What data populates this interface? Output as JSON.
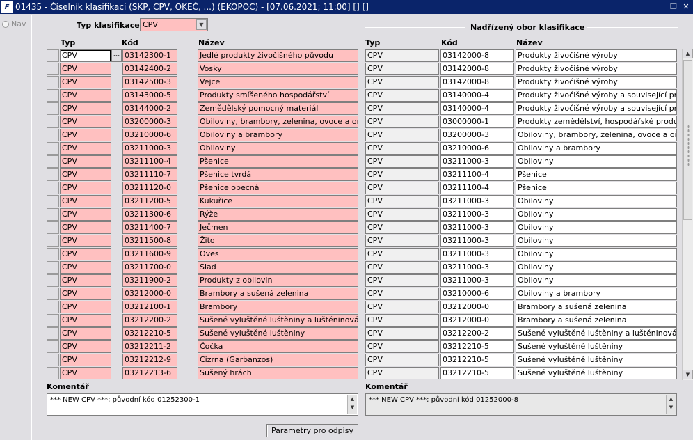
{
  "window": {
    "title": "01435 - Číselník klasifikací (SKP, CPV, OKEČ, ...) (EKOPOC) - [07.06.2021; 11:00]  [] []",
    "icon_text": "F"
  },
  "nav": {
    "label": "Nav"
  },
  "filter": {
    "label": "Typ klasifikace",
    "value": "CPV"
  },
  "left_headers": {
    "typ": "Typ",
    "kod": "Kód",
    "nazev": "Název"
  },
  "right_group": {
    "title": "Nadřízený obor klasifikace"
  },
  "right_headers": {
    "typ": "Typ",
    "kod": "Kód",
    "nazev": "Název"
  },
  "rows": [
    {
      "typ": "CPV",
      "kod": "03142300-1",
      "nazev": "Jedlé produkty živočišného původu",
      "p_typ": "CPV",
      "p_kod": "03142000-8",
      "p_nazev": "Produkty živočišné výroby"
    },
    {
      "typ": "CPV",
      "kod": "03142400-2",
      "nazev": "Vosky",
      "p_typ": "CPV",
      "p_kod": "03142000-8",
      "p_nazev": "Produkty živočišné výroby"
    },
    {
      "typ": "CPV",
      "kod": "03142500-3",
      "nazev": "Vejce",
      "p_typ": "CPV",
      "p_kod": "03142000-8",
      "p_nazev": "Produkty živočišné výroby"
    },
    {
      "typ": "CPV",
      "kod": "03143000-5",
      "nazev": "Produkty smíšeného hospodářství",
      "p_typ": "CPV",
      "p_kod": "03140000-4",
      "p_nazev": "Produkty živočišné výroby a související produkt"
    },
    {
      "typ": "CPV",
      "kod": "03144000-2",
      "nazev": "Zemědělský pomocný materiál",
      "p_typ": "CPV",
      "p_kod": "03140000-4",
      "p_nazev": "Produkty živočišné výroby a související produkt"
    },
    {
      "typ": "CPV",
      "kod": "03200000-3",
      "nazev": "Obiloviny, brambory, zelenina, ovoce a ořechy",
      "p_typ": "CPV",
      "p_kod": "03000000-1",
      "p_nazev": "Produkty zemědělství, hospodářské produkty, p"
    },
    {
      "typ": "CPV",
      "kod": "03210000-6",
      "nazev": "Obiloviny a brambory",
      "p_typ": "CPV",
      "p_kod": "03200000-3",
      "p_nazev": "Obiloviny, brambory, zelenina, ovoce a ořechy"
    },
    {
      "typ": "CPV",
      "kod": "03211000-3",
      "nazev": "Obiloviny",
      "p_typ": "CPV",
      "p_kod": "03210000-6",
      "p_nazev": "Obiloviny a brambory"
    },
    {
      "typ": "CPV",
      "kod": "03211100-4",
      "nazev": "Pšenice",
      "p_typ": "CPV",
      "p_kod": "03211000-3",
      "p_nazev": "Obiloviny"
    },
    {
      "typ": "CPV",
      "kod": "03211110-7",
      "nazev": "Pšenice tvrdá",
      "p_typ": "CPV",
      "p_kod": "03211100-4",
      "p_nazev": "Pšenice"
    },
    {
      "typ": "CPV",
      "kod": "03211120-0",
      "nazev": "Pšenice obecná",
      "p_typ": "CPV",
      "p_kod": "03211100-4",
      "p_nazev": "Pšenice"
    },
    {
      "typ": "CPV",
      "kod": "03211200-5",
      "nazev": "Kukuřice",
      "p_typ": "CPV",
      "p_kod": "03211000-3",
      "p_nazev": "Obiloviny"
    },
    {
      "typ": "CPV",
      "kod": "03211300-6",
      "nazev": "Rýže",
      "p_typ": "CPV",
      "p_kod": "03211000-3",
      "p_nazev": "Obiloviny"
    },
    {
      "typ": "CPV",
      "kod": "03211400-7",
      "nazev": "Ječmen",
      "p_typ": "CPV",
      "p_kod": "03211000-3",
      "p_nazev": "Obiloviny"
    },
    {
      "typ": "CPV",
      "kod": "03211500-8",
      "nazev": "Žito",
      "p_typ": "CPV",
      "p_kod": "03211000-3",
      "p_nazev": "Obiloviny"
    },
    {
      "typ": "CPV",
      "kod": "03211600-9",
      "nazev": "Oves",
      "p_typ": "CPV",
      "p_kod": "03211000-3",
      "p_nazev": "Obiloviny"
    },
    {
      "typ": "CPV",
      "kod": "03211700-0",
      "nazev": "Slad",
      "p_typ": "CPV",
      "p_kod": "03211000-3",
      "p_nazev": "Obiloviny"
    },
    {
      "typ": "CPV",
      "kod": "03211900-2",
      "nazev": "Produkty z obilovin",
      "p_typ": "CPV",
      "p_kod": "03211000-3",
      "p_nazev": "Obiloviny"
    },
    {
      "typ": "CPV",
      "kod": "03212000-0",
      "nazev": "Brambory a sušená zelenina",
      "p_typ": "CPV",
      "p_kod": "03210000-6",
      "p_nazev": "Obiloviny a brambory"
    },
    {
      "typ": "CPV",
      "kod": "03212100-1",
      "nazev": "Brambory",
      "p_typ": "CPV",
      "p_kod": "03212000-0",
      "p_nazev": "Brambory a sušená zelenina"
    },
    {
      "typ": "CPV",
      "kod": "03212200-2",
      "nazev": "Sušené vyluštěné luštěniny a luštěninová zelen",
      "p_typ": "CPV",
      "p_kod": "03212000-0",
      "p_nazev": "Brambory a sušená zelenina"
    },
    {
      "typ": "CPV",
      "kod": "03212210-5",
      "nazev": "Sušené vyluštěné luštěniny",
      "p_typ": "CPV",
      "p_kod": "03212200-2",
      "p_nazev": "Sušené vyluštěné luštěniny a luštěninová zelen"
    },
    {
      "typ": "CPV",
      "kod": "03212211-2",
      "nazev": "Čočka",
      "p_typ": "CPV",
      "p_kod": "03212210-5",
      "p_nazev": "Sušené vyluštěné luštěniny"
    },
    {
      "typ": "CPV",
      "kod": "03212212-9",
      "nazev": "Cizrna (Garbanzos)",
      "p_typ": "CPV",
      "p_kod": "03212210-5",
      "p_nazev": "Sušené vyluštěné luštěniny"
    },
    {
      "typ": "CPV",
      "kod": "03212213-6",
      "nazev": "Sušený hrách",
      "p_typ": "CPV",
      "p_kod": "03212210-5",
      "p_nazev": "Sušené vyluštěné luštěniny"
    }
  ],
  "comment_left": {
    "label": "Komentář",
    "value": "*** NEW CPV ***; původní kód 01252300-1"
  },
  "comment_right": {
    "label": "Komentář",
    "value": "*** NEW CPV ***; původní kód 01252000-8"
  },
  "button": {
    "label": "Parametry pro odpisy"
  },
  "colors": {
    "title_bar": "#0a246a",
    "required_field": "#ffc0c0",
    "window_bg": "#e0dfe3"
  }
}
